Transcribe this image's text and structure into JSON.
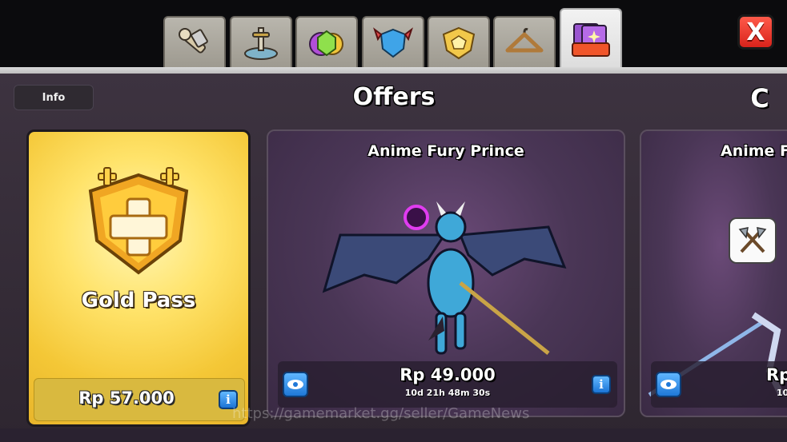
{
  "tabs": [
    {
      "icon": "builder-tools-icon"
    },
    {
      "icon": "sword-in-stone-icon"
    },
    {
      "icon": "gems-and-gold-icon"
    },
    {
      "icon": "winged-shield-icon"
    },
    {
      "icon": "gold-shield-badge-icon"
    },
    {
      "icon": "clothes-hanger-icon"
    },
    {
      "icon": "offers-cards-icon",
      "active": true
    }
  ],
  "header": {
    "close_label": "X",
    "info_label": "Info",
    "title": "Offers",
    "currency_label": "C"
  },
  "gold_pass": {
    "title": "Gold Pass",
    "price": "Rp 57.000",
    "info_label": "i"
  },
  "offers": [
    {
      "title": "Anime Fury Prince",
      "price": "Rp 49.000",
      "timer": "10d 21h 48m 30s",
      "info_label": "i"
    },
    {
      "title": "Anime F",
      "price": "Rp",
      "timer": "10"
    }
  ],
  "watermark": "https://gamemarket.gg/seller/GameNews",
  "colors": {
    "panel": "#3d3340",
    "gold": "#f4c736",
    "close": "#d8231b",
    "info_blue": "#1b74d6"
  }
}
